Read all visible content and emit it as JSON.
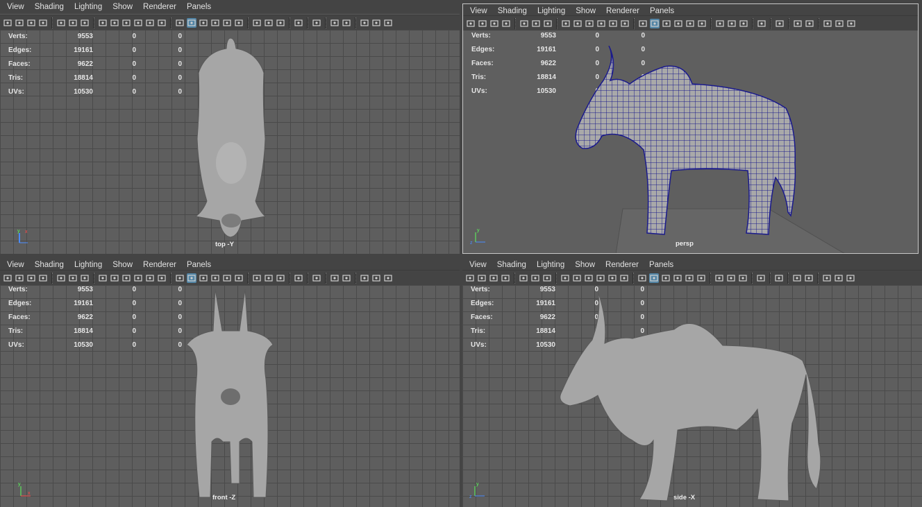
{
  "menu": [
    "View",
    "Shading",
    "Lighting",
    "Show",
    "Renderer",
    "Panels"
  ],
  "hud": {
    "labels": [
      "Verts:",
      "Edges:",
      "Faces:",
      "Tris:",
      "UVs:"
    ],
    "rows": [
      [
        "9553",
        "0",
        "0"
      ],
      [
        "19161",
        "0",
        "0"
      ],
      [
        "9622",
        "0",
        "0"
      ],
      [
        "18814",
        "0",
        "0"
      ],
      [
        "10530",
        "0",
        "0"
      ]
    ]
  },
  "panels": [
    {
      "camera": "top -Y"
    },
    {
      "camera": "persp"
    },
    {
      "camera": "front -Z"
    },
    {
      "camera": "side -X"
    }
  ],
  "colors": {
    "wireframe": "#1a1a8c",
    "selection": "#5285a6",
    "mesh": "#a9a9a9"
  },
  "icons": [
    "camera-icon",
    "film-icon",
    "bookmark-icon",
    "grid-toggle-icon",
    "wireframe-icon",
    "shaded-icon",
    "lighting-icon",
    "isolate-icon",
    "xray-icon",
    "snapshot-icon"
  ]
}
